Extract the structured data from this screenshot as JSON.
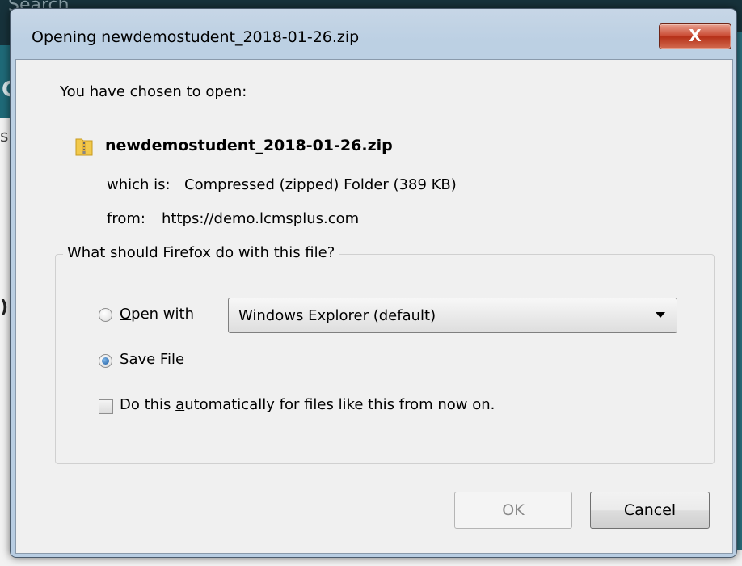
{
  "background": {
    "top_text": "Search",
    "left_letter": "C",
    "left_fragment": "s",
    "left_paren": ")"
  },
  "dialog": {
    "title": "Opening newdemostudent_2018-01-26.zip",
    "close_label": "X",
    "chosen_label": "You have chosen to open:",
    "file": {
      "icon": "zip-folder-icon",
      "name": "newdemostudent_2018-01-26.zip",
      "which_is_label": "which is:",
      "which_is_value": "Compressed (zipped) Folder (389 KB)",
      "from_label": "from:",
      "from_value": "https://demo.lcmsplus.com"
    },
    "group": {
      "caption": "What should Firefox do with this file?",
      "open_with": {
        "label_prefix": "",
        "access_key": "O",
        "label_rest": "pen with",
        "selected": false
      },
      "open_with_app": "Windows Explorer (default)",
      "save_file": {
        "access_key": "S",
        "label_rest": "ave File",
        "selected": true
      },
      "auto": {
        "label_before": "Do this ",
        "access_key": "a",
        "label_after": "utomatically for files like this from now on.",
        "checked": false
      }
    },
    "buttons": {
      "ok": "OK",
      "cancel": "Cancel"
    }
  }
}
